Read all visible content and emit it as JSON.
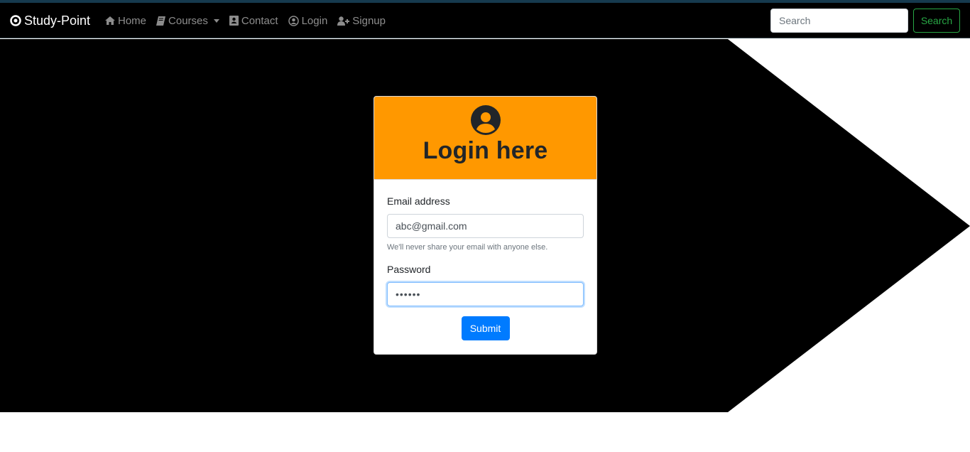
{
  "navbar": {
    "brand": "Study-Point",
    "links": [
      {
        "label": "Home",
        "icon": "home-icon"
      },
      {
        "label": "Courses",
        "icon": "book-icon",
        "dropdown": true
      },
      {
        "label": "Contact",
        "icon": "address-book-icon"
      },
      {
        "label": "Login",
        "icon": "user-circle-icon"
      },
      {
        "label": "Signup",
        "icon": "user-plus-icon"
      }
    ],
    "search_placeholder": "Search",
    "search_button": "Search"
  },
  "login_card": {
    "title": "Login here",
    "icon": "user-circle-icon",
    "email_label": "Email address",
    "email_value": "abc@gmail.com",
    "email_help": "We'll never share your email with anyone else.",
    "password_label": "Password",
    "password_value": "••••••",
    "submit_label": "Submit"
  },
  "colors": {
    "navbar_bg": "#000000",
    "card_header": "#ff9800",
    "primary": "#007bff",
    "success": "#28a745"
  }
}
